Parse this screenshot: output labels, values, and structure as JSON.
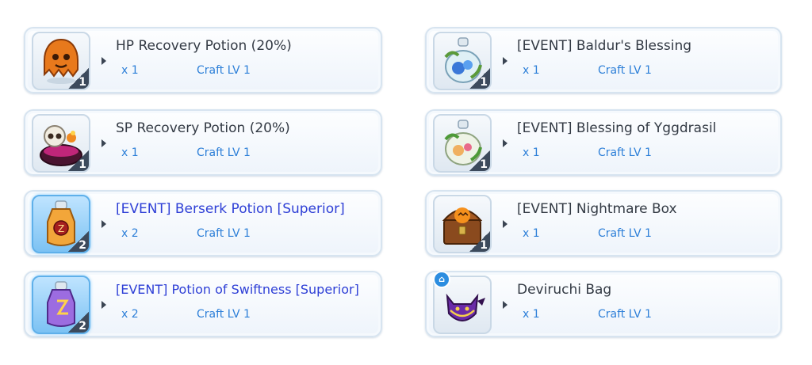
{
  "left_column": [
    {
      "title": "HP Recovery Potion (20%)",
      "quantity": "x 1",
      "craft": "Craft LV 1",
      "badge": "1",
      "icon": "orange-ghost-icon",
      "highlight": false
    },
    {
      "title": "SP Recovery Potion (20%)",
      "quantity": "x 1",
      "craft": "Craft LV 1",
      "badge": "1",
      "icon": "skull-cauldron-icon",
      "highlight": false
    },
    {
      "title": "[EVENT] Berserk Potion [Superior]",
      "quantity": "x 2",
      "craft": "Craft LV 1",
      "badge": "2",
      "icon": "berserk-potion-icon",
      "highlight": true
    },
    {
      "title": "[EVENT] Potion of Swiftness [Superior]",
      "quantity": "x 2",
      "craft": "Craft LV 1",
      "badge": "2",
      "icon": "swiftness-potion-icon",
      "highlight": true
    }
  ],
  "right_column": [
    {
      "title": "[EVENT] Baldur's Blessing",
      "quantity": "x 1",
      "craft": "Craft LV 1",
      "badge": "1",
      "icon": "blue-flower-potion-icon",
      "highlight": false
    },
    {
      "title": "[EVENT] Blessing of Yggdrasil",
      "quantity": "x 1",
      "craft": "Craft LV 1",
      "badge": "1",
      "icon": "leaf-potion-icon",
      "highlight": false
    },
    {
      "title": "[EVENT] Nightmare Box",
      "quantity": "x 1",
      "craft": "Craft LV 1",
      "badge": "1",
      "icon": "pumpkin-chest-icon",
      "highlight": false
    },
    {
      "title": "Deviruchi Bag",
      "quantity": "x 1",
      "craft": "Craft LV 1",
      "badge": "",
      "icon": "deviruchi-bag-icon",
      "highlight": false
    }
  ],
  "colors": {
    "label_blue": "#2d7fd8",
    "highlight_title": "#2e3fd6",
    "title_text": "#333a44"
  }
}
